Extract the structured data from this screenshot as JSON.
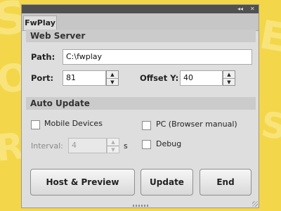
{
  "window": {
    "tab_label": "FwPlay",
    "collapse_glyph": "◂◂",
    "close_glyph": "✕"
  },
  "web_server": {
    "title": "Web Server",
    "path_label": "Path:",
    "path_value": "C:\\fwplay",
    "port_label": "Port:",
    "port_value": "81",
    "offset_label": "Offset Y:",
    "offset_value": "40"
  },
  "auto_update": {
    "title": "Auto Update",
    "mobile_label": "Mobile Devices",
    "pc_label": "PC (Browser manual)",
    "interval_label": "Interval:",
    "interval_value": "4",
    "interval_unit": "s",
    "debug_label": "Debug"
  },
  "buttons": {
    "host_preview": "Host & Preview",
    "update": "Update",
    "end": "End"
  }
}
